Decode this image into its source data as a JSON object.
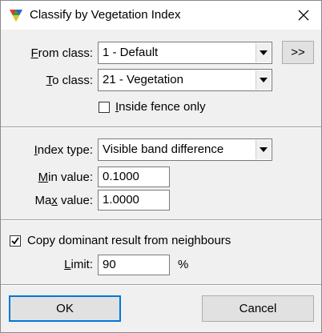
{
  "window": {
    "title": "Classify by Vegetation Index",
    "icon": "terrasolid-triangle-icon",
    "close_glyph": "✕"
  },
  "classes": {
    "from_label_u": "F",
    "from_label_rest": "rom class:",
    "from_value": "1 - Default",
    "to_label_u": "T",
    "to_label_rest": "o class:",
    "to_value": "21 - Vegetation",
    "more_button_label": ">>",
    "fence_label_u": "I",
    "fence_label_rest": "nside fence only",
    "fence_checked": false
  },
  "index": {
    "type_label_pre": "",
    "type_label_u": "I",
    "type_label_rest": "ndex type:",
    "type_value": "Visible band difference",
    "min_label_u": "M",
    "min_label_rest": "in value:",
    "min_value": "0.1000",
    "max_label_pre": "Ma",
    "max_label_u": "x",
    "max_label_rest": " value:",
    "max_value": "1.0000"
  },
  "neighbours": {
    "copy_label": "Copy dominant result from neighbours",
    "copy_checked": true,
    "limit_label_u": "L",
    "limit_label_rest": "imit:",
    "limit_value": "90",
    "limit_unit": "%"
  },
  "buttons": {
    "ok_label": "OK",
    "cancel_label": "Cancel"
  }
}
